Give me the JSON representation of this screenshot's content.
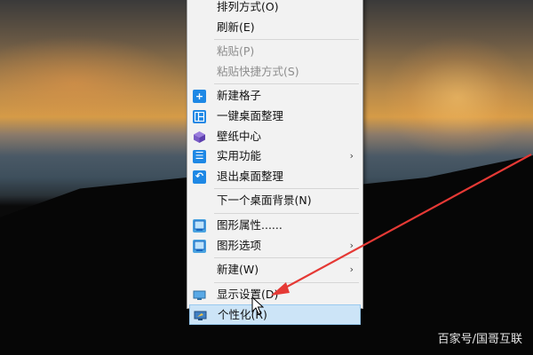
{
  "menu": {
    "items": [
      {
        "label": "排列方式(O)",
        "disabled": false
      },
      {
        "label": "刷新(E)",
        "disabled": false
      },
      {
        "label": "粘贴(P)",
        "disabled": true
      },
      {
        "label": "粘贴快捷方式(S)",
        "disabled": true
      },
      {
        "label": "新建格子",
        "icon": "plus-square-icon"
      },
      {
        "label": "一键桌面整理",
        "icon": "grid-layout-icon"
      },
      {
        "label": "壁纸中心",
        "icon": "cube-icon"
      },
      {
        "label": "实用功能",
        "icon": "list-icon",
        "submenu": true
      },
      {
        "label": "退出桌面整理",
        "icon": "undo-icon"
      },
      {
        "label": "下一个桌面背景(N)"
      },
      {
        "label": "图形属性......",
        "icon": "intel-graphics-icon"
      },
      {
        "label": "图形选项",
        "icon": "intel-graphics-icon",
        "submenu": true
      },
      {
        "label": "新建(W)",
        "submenu": true
      },
      {
        "label": "显示设置(D)",
        "icon": "monitor-icon"
      },
      {
        "label": "个性化(R)",
        "icon": "personalize-icon",
        "highlighted": true
      }
    ],
    "submenu_arrow": "›"
  },
  "watermark": "百家号/国哥互联",
  "colors": {
    "accent_blue": "#1e88e5",
    "highlight_bg": "#cce4f7",
    "annotation_red": "#e53935"
  }
}
